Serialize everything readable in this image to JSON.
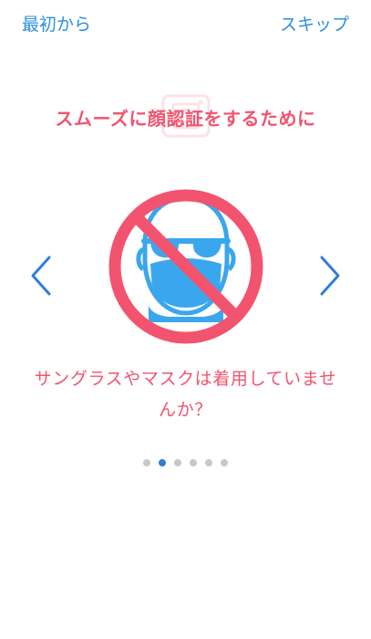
{
  "colors": {
    "link": "#2f8fe0",
    "accent": "#f2546f",
    "icon_blue": "#3aa6ee",
    "dot_inactive": "#c8c8c8",
    "dot_active": "#2f7fd6"
  },
  "nav": {
    "restart_label": "最初から",
    "skip_label": "スキップ"
  },
  "headline": "スムーズに顔認証をするために",
  "question": {
    "line1": "サングラスやマスクは着用していませ",
    "line2": "んか？"
  },
  "icons": {
    "background": "camera-frame-icon",
    "prev": "chevron-left-icon",
    "next": "chevron-right-icon",
    "illustration": "no-sunglasses-mask-icon"
  },
  "pager": {
    "total": 6,
    "active_index": 1
  }
}
